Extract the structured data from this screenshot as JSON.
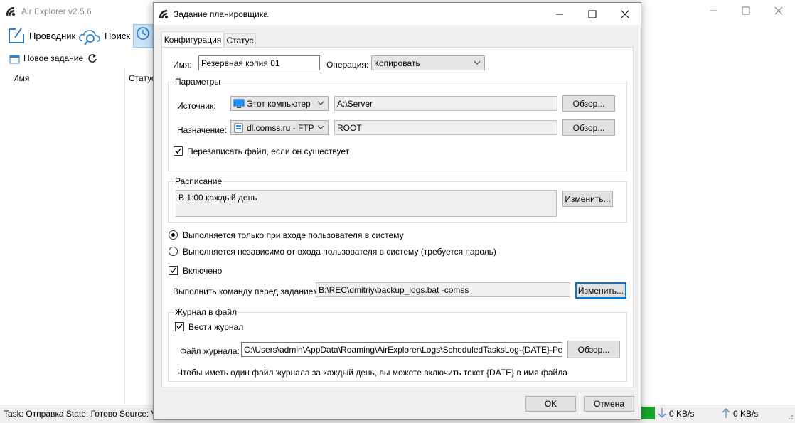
{
  "app": {
    "title": "Air Explorer v2.5.6",
    "ribbon": {
      "explorer": "Проводник",
      "search": "Поиск"
    },
    "toolbar": {
      "new_task": "Новое задание"
    },
    "columns": {
      "name": "Имя",
      "status": "Статус"
    },
    "statusbar": {
      "task_info": "Task: Отправка State: Готово Source: V:\\",
      "download": "0 KB/s",
      "upload": "0 KB/s"
    }
  },
  "dialog": {
    "title": "Задание планировщика",
    "tabs": {
      "config": "Конфигурация",
      "status": "Статус"
    },
    "name_label": "Имя:",
    "name_value": "Резервная копия 01",
    "operation_label": "Операция:",
    "operation_value": "Копировать",
    "params": {
      "title": "Параметры",
      "source_label": "Источник:",
      "source_combo": "Этот компьютер",
      "source_path": "A:\\Server",
      "dest_label": "Назначение:",
      "dest_combo": "dl.comss.ru - FTP",
      "dest_path": "ROOT",
      "browse": "Обзор...",
      "overwrite": "Перезаписать файл, если он существует"
    },
    "schedule": {
      "title": "Расписание",
      "text": "В 1:00 каждый день",
      "change": "Изменить..."
    },
    "run_only_logged": "Выполняется только при входе пользователя в систему",
    "run_independent": "Выполняется независимо от входа пользователя в систему (требуется пароль)",
    "enabled": "Включено",
    "pre_command_label": "Выполнить команду перед заданием:",
    "pre_command_value": "B:\\REC\\dmitriy\\backup_logs.bat -comss",
    "pre_command_change": "Изменить...",
    "log": {
      "title": "Журнал в файл",
      "keep_log": "Вести журнал",
      "file_label": "Файл журнала:",
      "file_value": "C:\\Users\\admin\\AppData\\Roaming\\AirExplorer\\Logs\\ScheduledTasksLog-{DATE}-Резервна",
      "browse": "Обзор...",
      "hint": "Чтобы иметь один файл журнала за каждый день, вы можете включить текст {DATE} в имя файла"
    },
    "ok": "OK",
    "cancel": "Отмена"
  },
  "colors": {
    "accent": "#0078d7",
    "progress": "#16a42b"
  }
}
